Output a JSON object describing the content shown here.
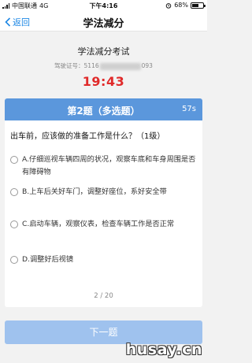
{
  "status_bar": {
    "carrier": "中国联通",
    "network": "4G",
    "time": "下午4:16",
    "battery": "68%",
    "battery_level": 0.68
  },
  "nav": {
    "back_label": "返回",
    "title": "学法减分"
  },
  "exam": {
    "name": "学法减分考试",
    "license_prefix": "驾驶证号：",
    "license_start": "5116",
    "license_end": "093",
    "timer": "19:43"
  },
  "question": {
    "number_label": "第2题（多选题）",
    "seconds": "57s",
    "text": "出车前，应该做的准备工作是什么？（1级）",
    "options": [
      {
        "label": "A.仔细巡视车辆四周的状况，观察车底和车身周围是否有障碍物"
      },
      {
        "label": "B.上车后关好车门，调整好座位，系好安全带"
      },
      {
        "label": "C.启动车辆，观察仪表，检查车辆工作是否正常"
      },
      {
        "label": "D.调整好后视镜"
      }
    ],
    "progress": "2 / 20"
  },
  "next_button": "下一题",
  "watermark": "husay.cn",
  "colors": {
    "accent": "#1e88e5",
    "header_blue": "#5b97dc",
    "button_disabled": "#9fc2ee",
    "timer_red": "#e02a2a"
  }
}
